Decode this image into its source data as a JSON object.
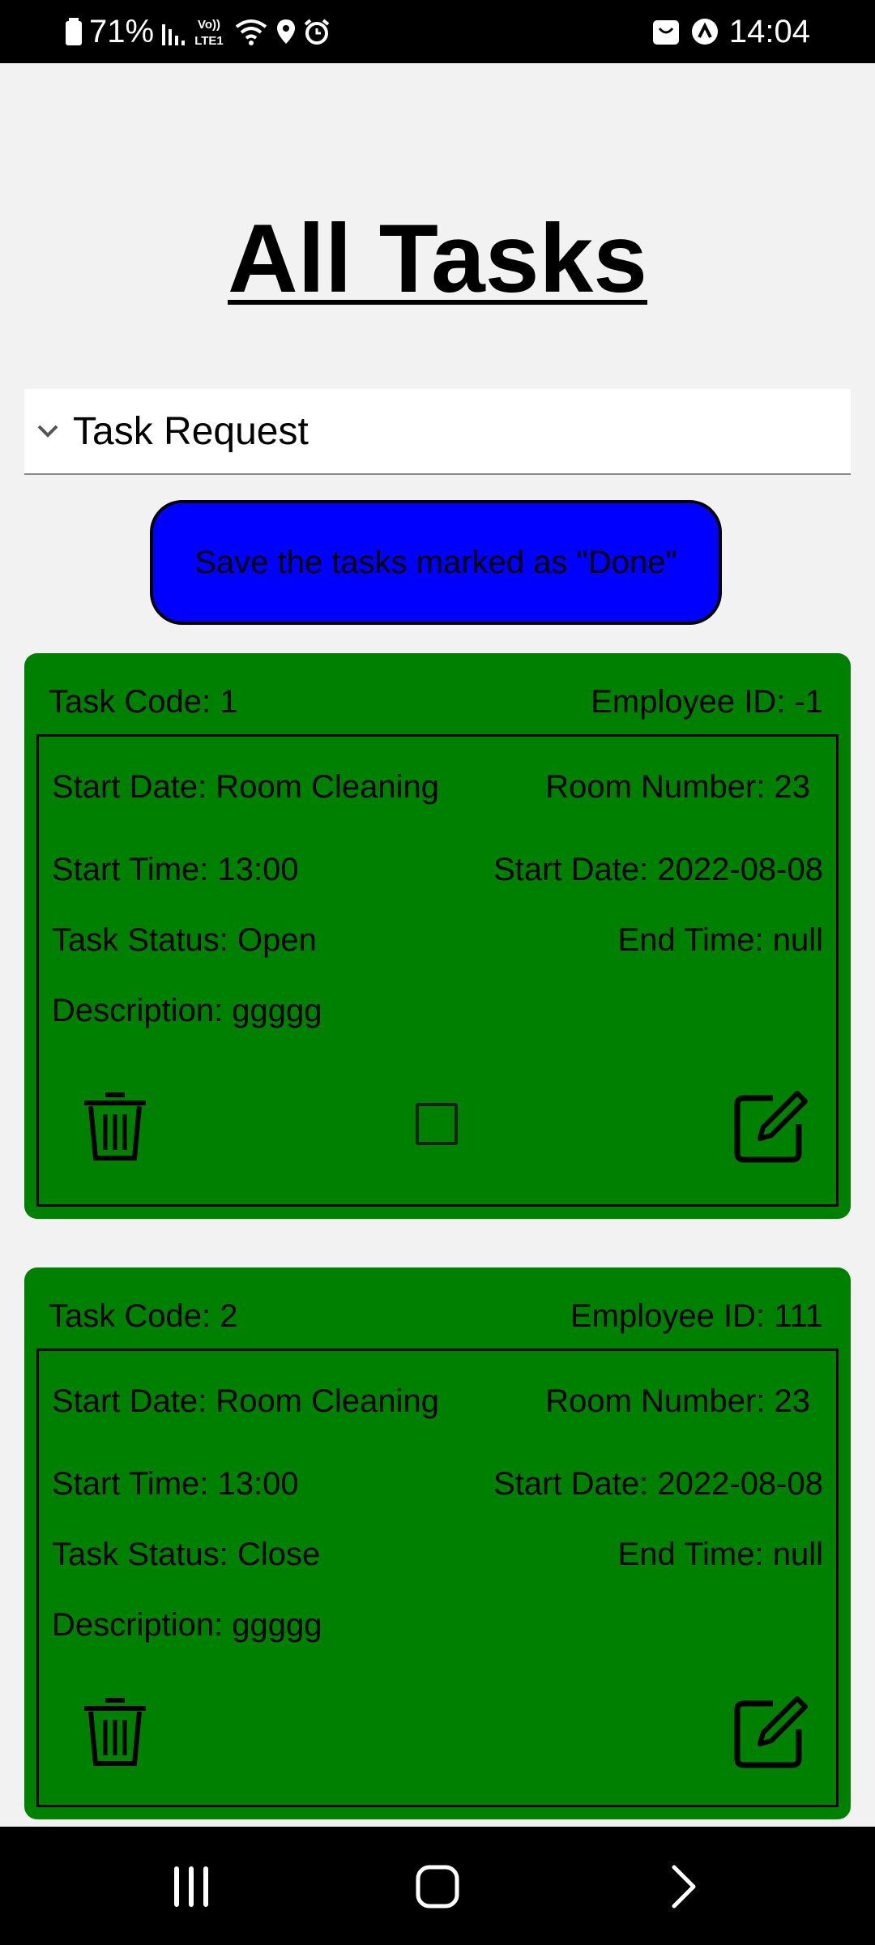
{
  "status_bar": {
    "battery": "71%",
    "time": "14:04",
    "icons": [
      "battery-icon",
      "signal-icon",
      "volte-icon",
      "wifi-icon",
      "location-icon",
      "alarm-icon",
      "shopping-bag-icon",
      "app-icon"
    ]
  },
  "page": {
    "title": "All Tasks"
  },
  "dropdown": {
    "label": "Task Request"
  },
  "save_button": {
    "label": "Save the tasks marked as \"Done\""
  },
  "colors": {
    "background": "#f2f2f2",
    "card": "#008000",
    "button": "#0000ff"
  },
  "tasks": [
    {
      "task_code": "Task Code: 1",
      "employee_id": "Employee ID: -1",
      "start_date_type": "Start Date: Room Cleaning",
      "room_number": "Room Number: 23",
      "start_time": "Start Time: 13:00",
      "start_date": "Start Date: 2022-08-08",
      "status": "Task Status: Open",
      "end_time": "End Time: null",
      "description": "Description: ggggg",
      "has_checkbox": true
    },
    {
      "task_code": "Task Code: 2",
      "employee_id": "Employee ID: 111",
      "start_date_type": "Start Date: Room Cleaning",
      "room_number": "Room Number: 23",
      "start_time": "Start Time: 13:00",
      "start_date": "Start Date: 2022-08-08",
      "status": "Task Status: Close",
      "end_time": "End Time: null",
      "description": "Description: ggggg",
      "has_checkbox": false
    }
  ],
  "nav_bar": {
    "icons": [
      "recent-apps-icon",
      "home-icon",
      "back-icon"
    ]
  }
}
